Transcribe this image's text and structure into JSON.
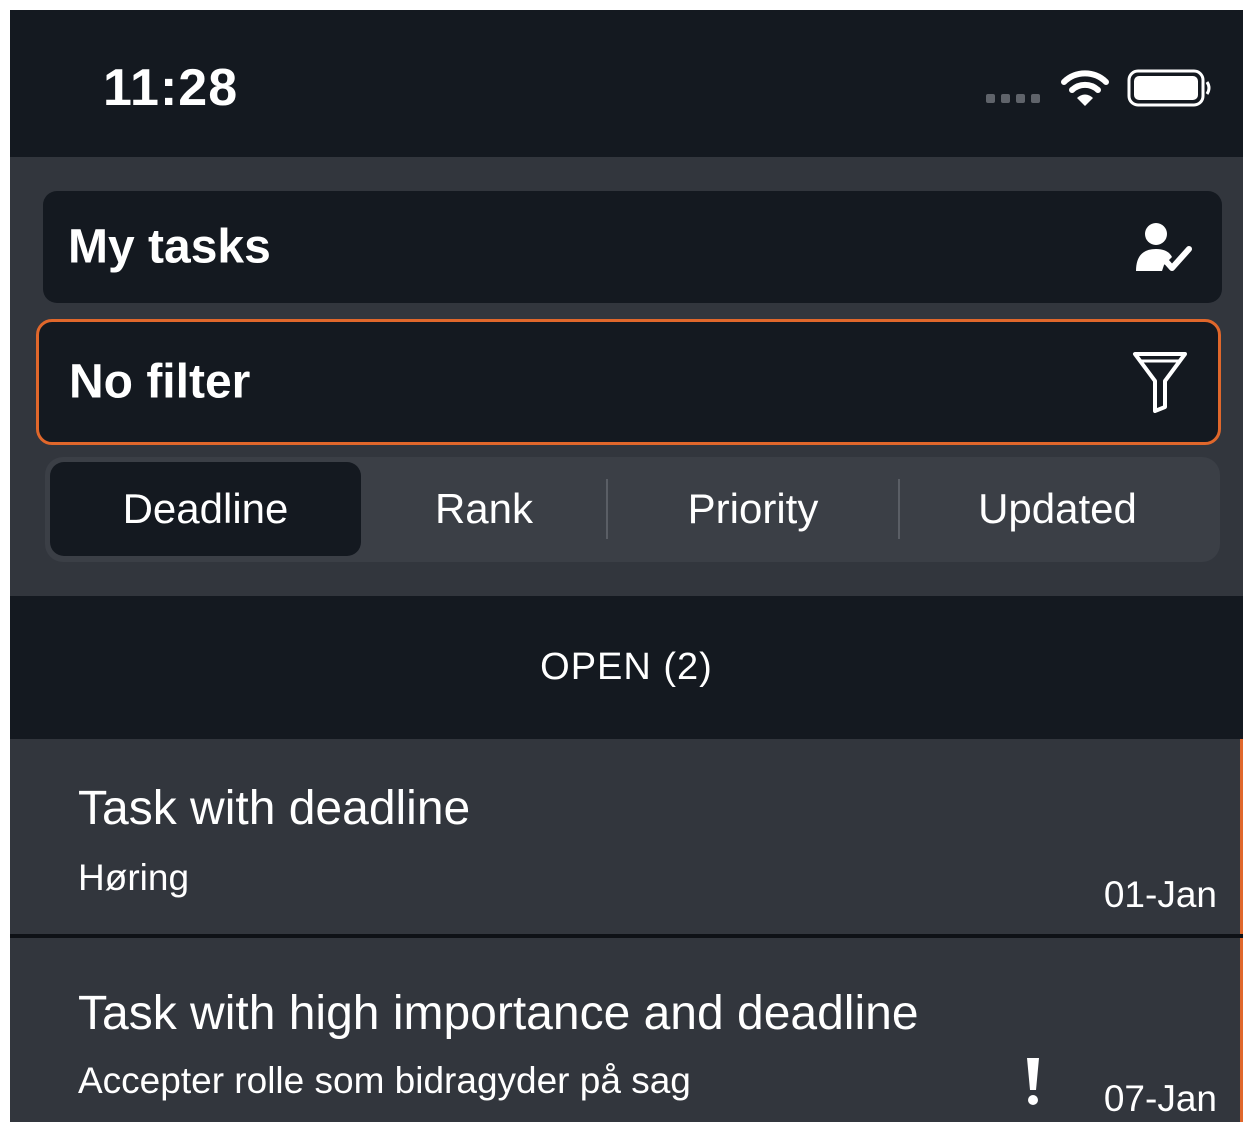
{
  "status_bar": {
    "time": "11:28",
    "icons": [
      "signal-dots-icon",
      "wifi-icon",
      "battery-icon"
    ]
  },
  "task_selector": {
    "label": "My tasks",
    "icon": "person-check-icon"
  },
  "filter_selector": {
    "label": "No filter",
    "icon": "funnel-icon",
    "border_color": "#e0672b"
  },
  "sort_segments": {
    "selected": "Deadline",
    "items": [
      {
        "label": "Deadline"
      },
      {
        "label": "Rank"
      },
      {
        "label": "Priority"
      },
      {
        "label": "Updated"
      }
    ]
  },
  "section": {
    "title": "OPEN (2)"
  },
  "tasks": [
    {
      "title": "Task with deadline",
      "subtitle": "Høring",
      "date": "01-Jan",
      "high_importance": false
    },
    {
      "title": "Task with high importance and deadline",
      "subtitle": "Accepter rolle som bidragyder på sag",
      "date": "07-Jan",
      "high_importance": true
    }
  ],
  "colors": {
    "background_dark": "#141920",
    "surface": "#32363d",
    "accent": "#e0672b",
    "text": "#ffffff"
  }
}
